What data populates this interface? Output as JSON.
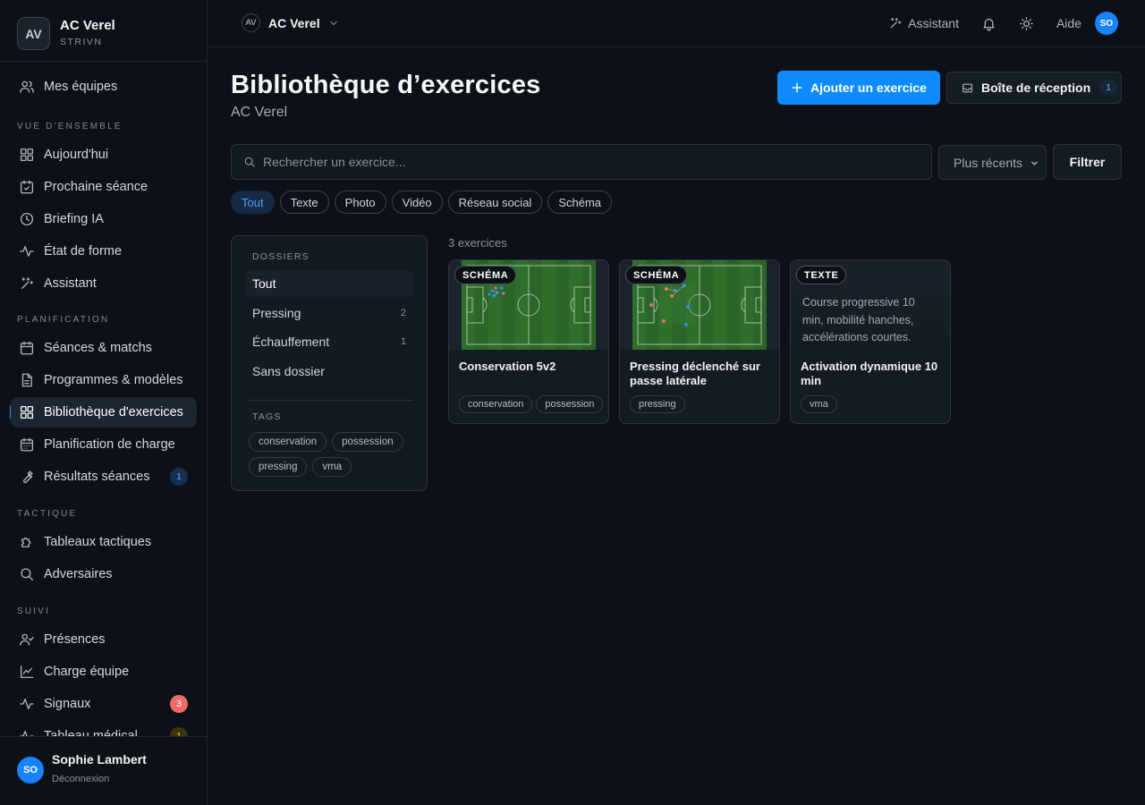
{
  "workspace": {
    "initials": "AV",
    "name": "AC Verel",
    "brand": "STRIVN"
  },
  "sidebar": {
    "my_teams": "Mes équipes",
    "sections": {
      "overview": "VUE D'ENSEMBLE",
      "planning": "PLANIFICATION",
      "tactics": "TACTIQUE",
      "tracking": "SUIVI"
    },
    "items": {
      "today": "Aujourd'hui",
      "next_session": "Prochaine séance",
      "briefing": "Briefing IA",
      "fitness": "État de forme",
      "assistant": "Assistant",
      "sessions": "Séances & matchs",
      "programs": "Programmes & modèles",
      "library": "Bibliothèque d'exercices",
      "load": "Planification de charge",
      "results": "Résultats séances",
      "boards": "Tableaux tactiques",
      "opponents": "Adversaires",
      "attendance": "Présences",
      "team_load": "Charge équipe",
      "signals": "Signaux",
      "medical": "Tableau médical"
    },
    "badges": {
      "results": "1",
      "signals": "3",
      "medical": "1"
    }
  },
  "user": {
    "initials": "SO",
    "name": "Sophie Lambert",
    "logout": "Déconnexion"
  },
  "topbar": {
    "team_initials": "AV",
    "team_name": "AC Verel",
    "assistant": "Assistant",
    "help": "Aide",
    "avatar": "SO"
  },
  "page": {
    "title": "Bibliothèque d’exercices",
    "subtitle": "AC Verel",
    "add_button": "Ajouter un exercice",
    "inbox_button": "Boîte de réception",
    "inbox_count": "1"
  },
  "search": {
    "placeholder": "Rechercher un exercice...",
    "value": ""
  },
  "sort": {
    "selected": "Plus récents"
  },
  "filter_button": "Filtrer",
  "type_filters": [
    "Tout",
    "Texte",
    "Photo",
    "Vidéo",
    "Réseau social",
    "Schéma"
  ],
  "folders": {
    "label": "DOSSIERS",
    "items": [
      {
        "name": "Tout",
        "count": ""
      },
      {
        "name": "Pressing",
        "count": "2"
      },
      {
        "name": "Échauffement",
        "count": "1"
      },
      {
        "name": "Sans dossier",
        "count": ""
      }
    ],
    "tags_label": "TAGS",
    "tags": [
      "conservation",
      "possession",
      "pressing",
      "vma"
    ]
  },
  "results_count": "3 exercices",
  "exercises": [
    {
      "type": "SCHÉMA",
      "title": "Conservation 5v2",
      "description": "",
      "tags": [
        "conservation",
        "possession"
      ]
    },
    {
      "type": "SCHÉMA",
      "title": "Pressing déclenché sur passe latérale",
      "description": "",
      "tags": [
        "pressing"
      ]
    },
    {
      "type": "TEXTE",
      "title": "Activation dynamique 10 min",
      "description": "Course progressive 10 min, mobilité hanches, accélérations courtes.",
      "tags": [
        "vma"
      ]
    }
  ],
  "colors": {
    "accent": "#0d8bff",
    "background": "#0d1117",
    "panel": "#141a22",
    "danger_badge": "#f06a6a",
    "pitch": "#2d6a2a"
  }
}
